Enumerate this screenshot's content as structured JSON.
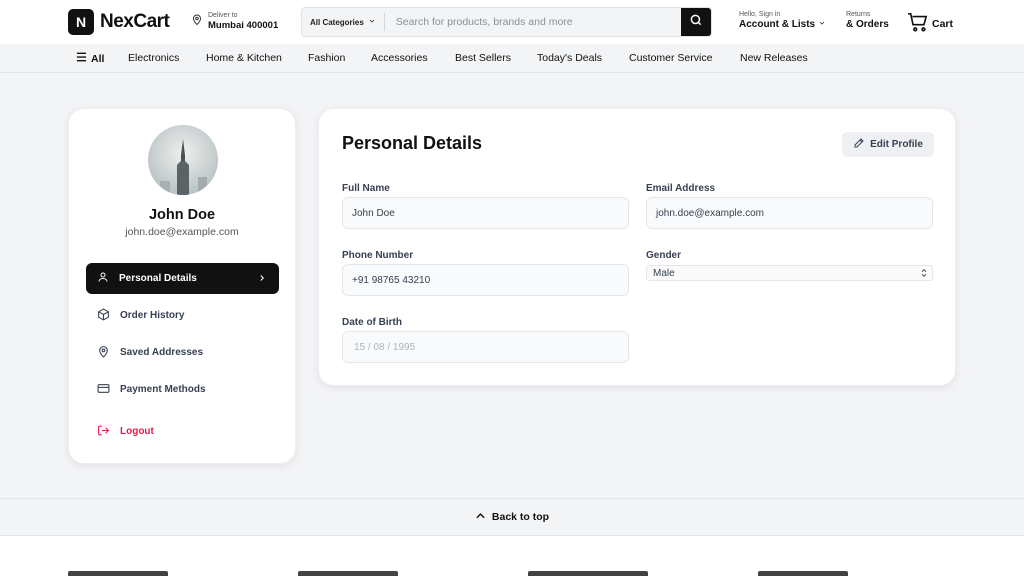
{
  "header": {
    "logo_letter": "N",
    "brand": "NexCart",
    "deliver_small": "Deliver to",
    "deliver_location": "Mumbai 400001",
    "search_category": "All Categories",
    "search_placeholder": "Search for products, brands and more",
    "account_small": "Hello, Sign in",
    "account_big": "Account & Lists",
    "returns_small": "Returns",
    "returns_big": "& Orders",
    "cart_label": "Cart"
  },
  "nav": {
    "all_label": "All",
    "items": [
      "Electronics",
      "Home & Kitchen",
      "Fashion",
      "Accessories",
      "Best Sellers",
      "Today's Deals",
      "Customer Service",
      "New Releases"
    ]
  },
  "profile": {
    "name": "John Doe",
    "email": "john.doe@example.com"
  },
  "sidebar": {
    "items": [
      {
        "label": "Personal Details",
        "icon": "user-icon",
        "active": true
      },
      {
        "label": "Order History",
        "icon": "box-icon"
      },
      {
        "label": "Saved Addresses",
        "icon": "map-pin-icon"
      },
      {
        "label": "Payment Methods",
        "icon": "credit-card-icon"
      }
    ],
    "logout_label": "Logout"
  },
  "details": {
    "title": "Personal Details",
    "edit_label": "Edit Profile",
    "full_name_label": "Full Name",
    "full_name_value": "John Doe",
    "email_label": "Email Address",
    "email_value": "john.doe@example.com",
    "phone_label": "Phone Number",
    "phone_value": "+91 98765 43210",
    "gender_label": "Gender",
    "gender_value": "Male",
    "dob_label": "Date of Birth",
    "dob_value": "15 / 08 / 1995"
  },
  "footer": {
    "back_to_top": "Back to top"
  },
  "colors": {
    "accent": "#111111",
    "logout": "#e11d48",
    "background": "#f3f4f6"
  }
}
